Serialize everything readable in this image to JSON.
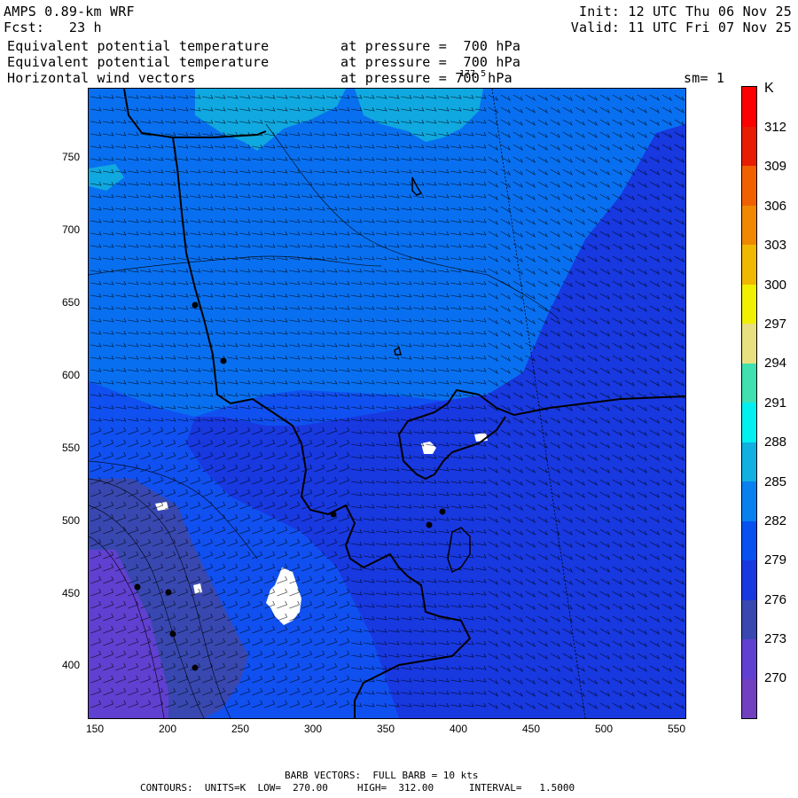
{
  "header": {
    "model": "AMPS 0.89-km WRF",
    "forecast": "Fcst:   23 h",
    "init": "Init: 12 UTC Thu 06 Nov 25",
    "valid": "Valid: 11 UTC Fri 07 Nov 25",
    "field1": "Equivalent potential temperature",
    "field1_level": "at pressure =  700 hPa",
    "field2": "Equivalent potential temperature",
    "field2_level": "at pressure =  700 hPa",
    "field3": "Horizontal wind vectors",
    "field3_level": "at pressure = 700 hPa",
    "field3_overlay": "177.5",
    "smoothing": "sm= 1"
  },
  "colorbar": {
    "unit": "K",
    "labels": [
      "312",
      "309",
      "306",
      "303",
      "300",
      "297",
      "294",
      "291",
      "288",
      "285",
      "282",
      "279",
      "276",
      "273",
      "270"
    ],
    "colors_top_to_bottom": [
      "#ff0000",
      "#e81c00",
      "#f06000",
      "#f08800",
      "#f0b800",
      "#f0f000",
      "#e8e080",
      "#40e0b0",
      "#00f0f0",
      "#10b0e0",
      "#0880f0",
      "#0850f0",
      "#1838e0",
      "#3848b0",
      "#6040d0",
      "#7040c0"
    ]
  },
  "map": {
    "x_ticks": [
      "150",
      "200",
      "250",
      "300",
      "350",
      "400",
      "450",
      "500",
      "550"
    ],
    "y_ticks": [
      "750",
      "700",
      "650",
      "600",
      "550",
      "500",
      "450",
      "400"
    ],
    "colors": {
      "region_285": "#10b0e0",
      "region_282": "#0880f0",
      "region_279": "#1050f0",
      "region_276": "#1838e0",
      "region_273": "#3848b0",
      "region_270": "#6040d0",
      "missing": "#ffffff"
    }
  },
  "footer": {
    "barb": "BARB VECTORS:  FULL BARB = 10 kts",
    "contours": "CONTOURS:  UNITS=K  LOW=  270.00     HIGH=  312.00      INTERVAL=   1.5000"
  }
}
